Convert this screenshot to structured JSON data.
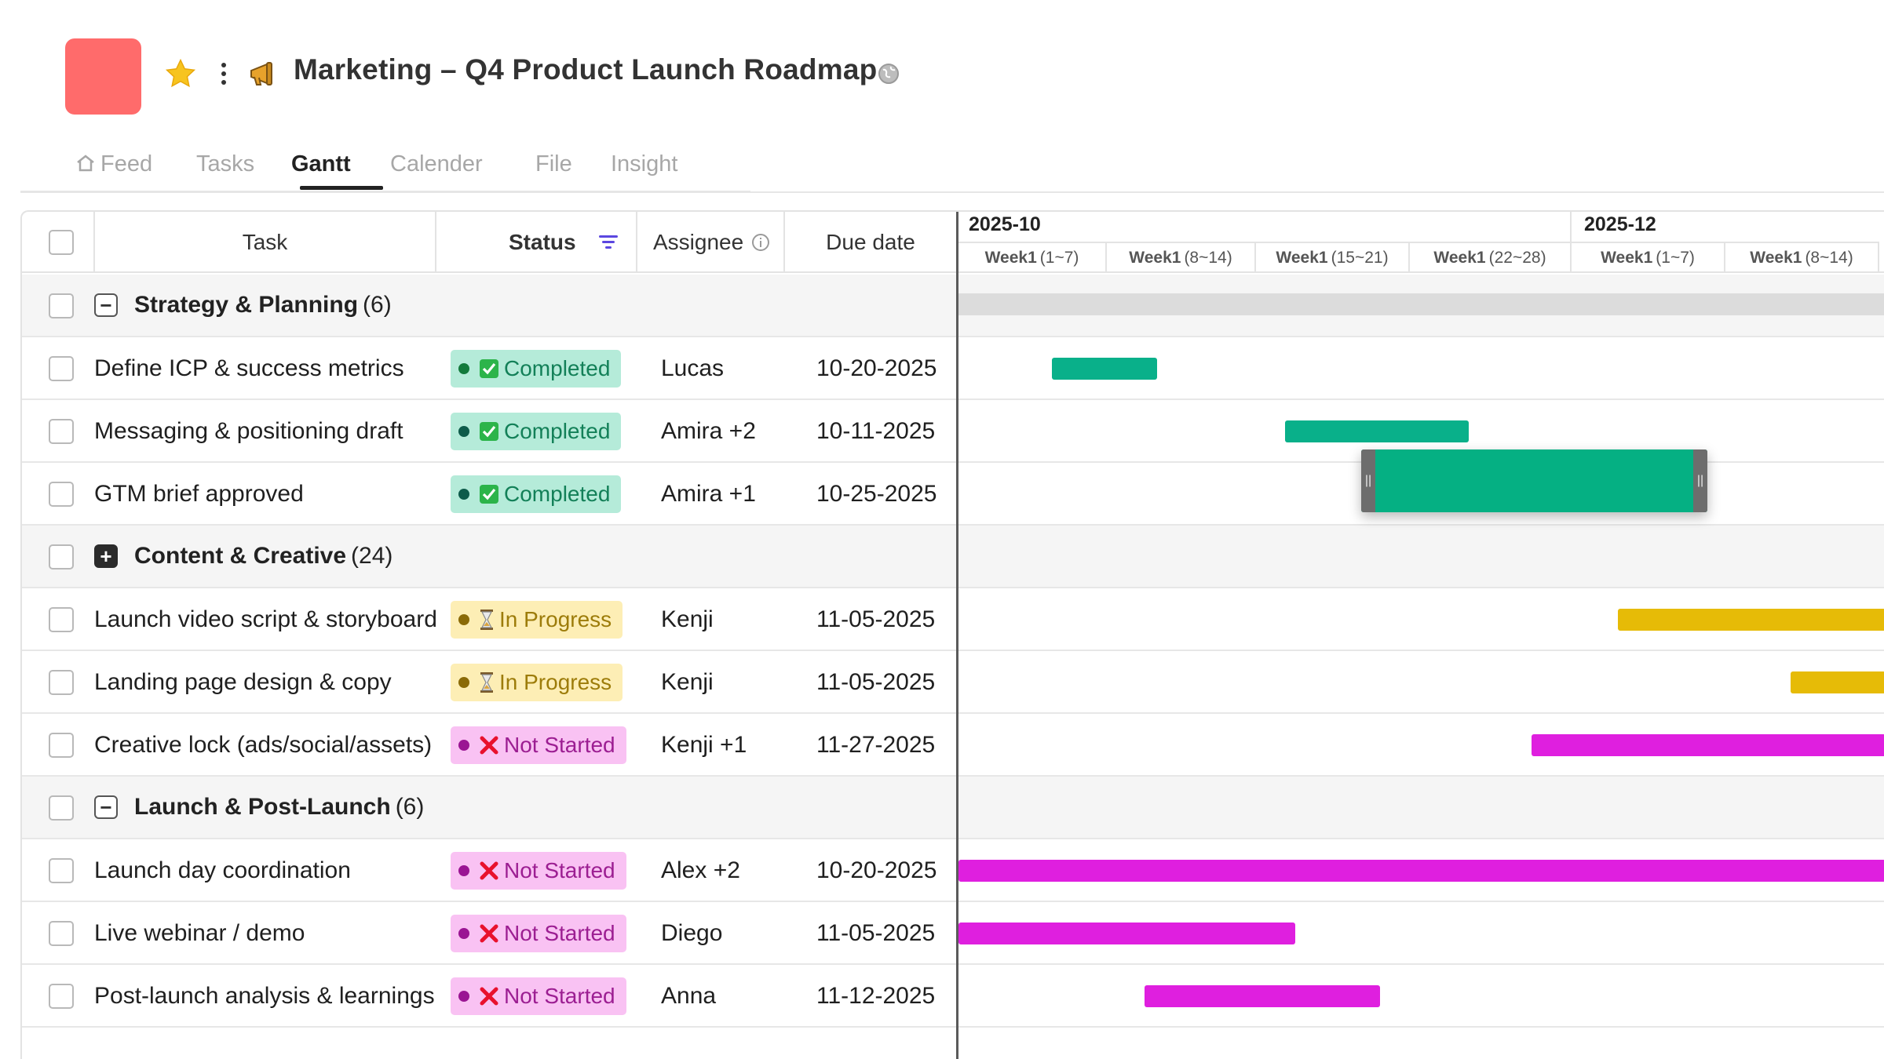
{
  "header": {
    "title": "Marketing – Q4 Product Launch Roadmap",
    "icons": [
      "favorite-star-icon",
      "more-options-icon",
      "megaphone-icon",
      "globe-icon"
    ],
    "accent_color": "#ff6b6b"
  },
  "tabs": [
    {
      "label": "Feed",
      "icon": "home-icon",
      "active": false
    },
    {
      "label": "Tasks",
      "active": false
    },
    {
      "label": "Gantt",
      "active": true
    },
    {
      "label": "Calender",
      "active": false
    },
    {
      "label": "File",
      "active": false
    },
    {
      "label": "Insight",
      "active": false
    }
  ],
  "table": {
    "columns": {
      "task": "Task",
      "status": "Status",
      "assignee": "Assignee",
      "due_date": "Due date"
    },
    "groups": [
      {
        "label": "Strategy & Planning",
        "count": "(6)",
        "expanded": true
      },
      {
        "label": "Content & Creative",
        "count": "(24)",
        "expanded": false
      },
      {
        "label": "Launch & Post-Launch",
        "count": "(6)",
        "expanded": true
      }
    ],
    "rows": [
      {
        "task": "Define ICP & success metrics",
        "status": "Completed",
        "assignee": "Lucas",
        "due": "10-20-2025"
      },
      {
        "task": "Messaging & positioning draft",
        "status": "Completed",
        "assignee": "Amira +2",
        "due": "10-11-2025"
      },
      {
        "task": "GTM brief approved",
        "status": "Completed",
        "assignee": "Amira +1",
        "due": "10-25-2025"
      },
      {
        "task": "Launch video script & storyboard",
        "status": "In Progress",
        "assignee": "Kenji",
        "due": "11-05-2025"
      },
      {
        "task": "Landing page design & copy",
        "status": "In Progress",
        "assignee": "Kenji",
        "due": "11-05-2025"
      },
      {
        "task": "Creative lock (ads/social/assets)",
        "status": "Not Started",
        "assignee": "Kenji +1",
        "due": "11-27-2025"
      },
      {
        "task": "Launch day coordination",
        "status": "Not Started",
        "assignee": "Alex +2",
        "due": "10-20-2025"
      },
      {
        "task": "Live webinar / demo",
        "status": "Not Started",
        "assignee": "Diego",
        "due": "11-05-2025"
      },
      {
        "task": "Post-launch analysis & learnings",
        "status": "Not Started",
        "assignee": "Anna",
        "due": "11-12-2025"
      }
    ]
  },
  "timeline": {
    "months": [
      "2025-10",
      "2025-12"
    ],
    "weeks": [
      {
        "label": "Week1",
        "range": "(1~7)"
      },
      {
        "label": "Week1",
        "range": "(8~14)"
      },
      {
        "label": "Week1",
        "range": "(15~21)"
      },
      {
        "label": "Week1",
        "range": "(22~28)"
      },
      {
        "label": "Week1",
        "range": "(1~7)"
      },
      {
        "label": "Week1",
        "range": "(8~14)"
      }
    ]
  },
  "status_styles": {
    "Completed": {
      "color": "#09b08a",
      "icon": "check-box-icon"
    },
    "In Progress": {
      "color": "#e6bb07",
      "icon": "hourglass-icon"
    },
    "Not Started": {
      "color": "#df1fdf",
      "icon": "cross-icon"
    }
  }
}
